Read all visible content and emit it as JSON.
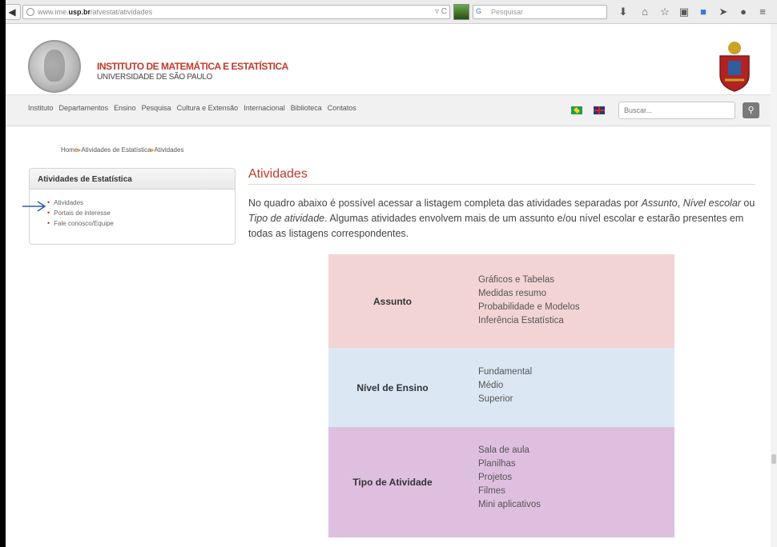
{
  "browser": {
    "url_prefix": "www.ime.",
    "url_domain": "usp.br",
    "url_path": "/atvestat/atividades",
    "search_placeholder": "Pesquisar"
  },
  "header": {
    "institute": "INSTITUTO DE MATEMÁTICA E ESTATÍSTICA",
    "university": "UNIVERSIDADE DE SÃO PAULO"
  },
  "nav": {
    "items": [
      "Instituto",
      "Departamentos",
      "Ensino",
      "Pesquisa",
      "Cultura e Extensão",
      "Internacional",
      "Biblioteca",
      "Contatos"
    ],
    "search_placeholder": "Buscar..."
  },
  "breadcrumb": {
    "home": "Home",
    "level1": "Atividades de Estatística",
    "current": "Atividades",
    "separator": "▸"
  },
  "sidebar": {
    "title": "Atividades de Estatística",
    "items": [
      "Atividades",
      "Portais de interesse",
      "Fale conosco/Equipe"
    ]
  },
  "main": {
    "title": "Atividades",
    "intro_part1": "No quadro abaixo é possível acessar a listagem completa das atividades separadas por ",
    "intro_em1": "Assunto",
    "intro_part2": ", ",
    "intro_em2": "Nível escolar",
    "intro_part3": " ou ",
    "intro_em3": "Tipo de atividade",
    "intro_part4": ". Algumas atividades envolvem mais de um assunto e/ou nível escolar e estarão presentes em todas as listagens correspondentes."
  },
  "table": {
    "rows": [
      {
        "label": "Assunto",
        "color": "#f3d4d4",
        "items": [
          "Gráficos e Tabelas",
          "Medidas resumo",
          "Probabilidade e Modelos",
          "Inferência Estatística"
        ]
      },
      {
        "label": "Nível de Ensino",
        "color": "#dbe8f4",
        "items": [
          "Fundamental",
          "Médio",
          "Superior"
        ]
      },
      {
        "label": "Tipo de Atividade",
        "color": "#dfbfe0",
        "items": [
          "Sala de aula",
          "Planilhas",
          "Projetos",
          "Filmes",
          "Mini aplicativos"
        ]
      }
    ]
  },
  "colors": {
    "accent_red": "#c0392b",
    "breadcrumb_separator": "#e68a00",
    "arrow_annotation": "#2a5db0"
  }
}
